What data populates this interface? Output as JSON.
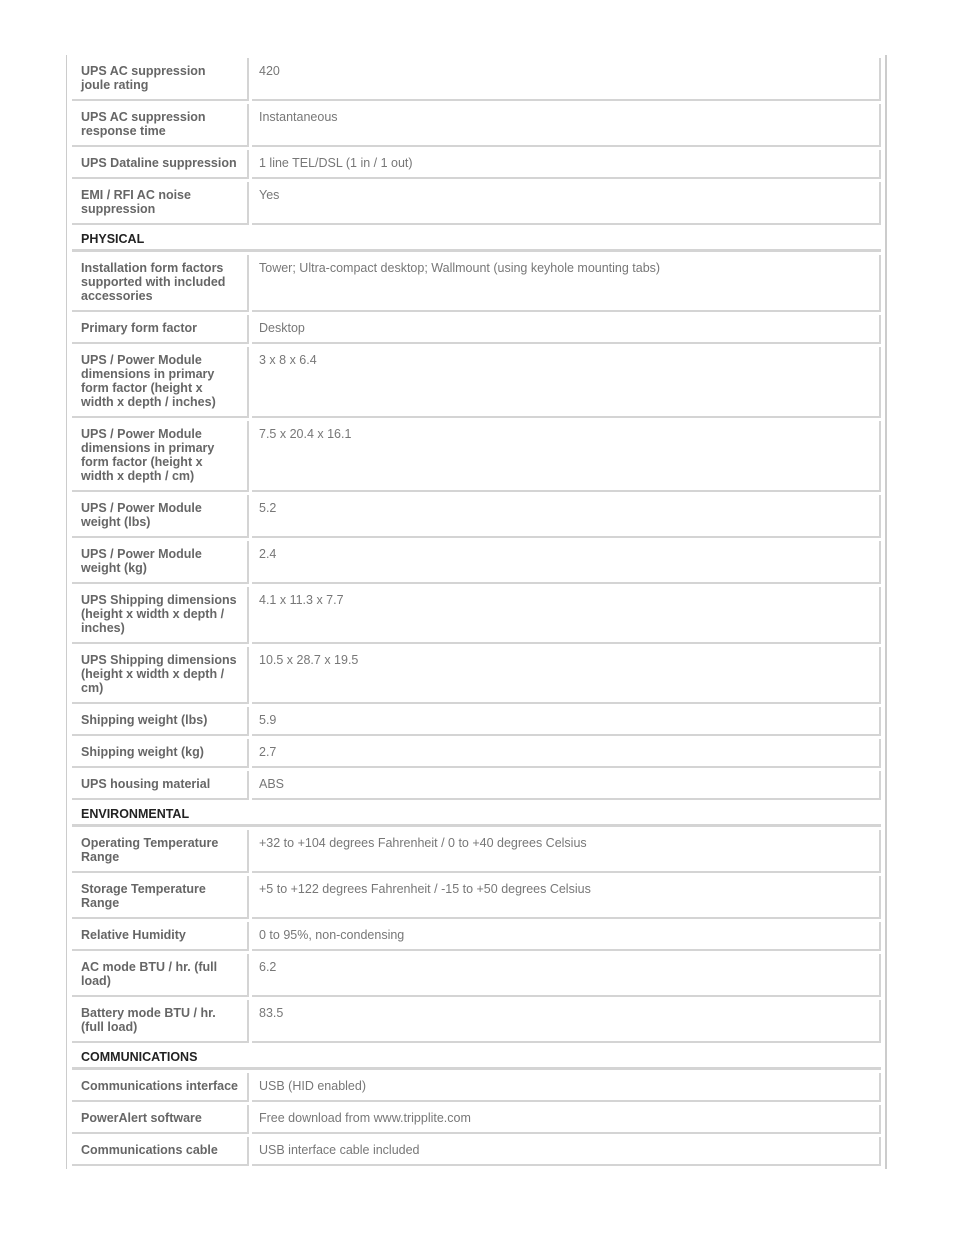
{
  "rows": [
    {
      "type": "row",
      "label": "UPS AC suppression joule rating",
      "value": "420",
      "h": 40
    },
    {
      "type": "row",
      "label": "UPS AC suppression response time",
      "value": "Instantaneous",
      "h": 40
    },
    {
      "type": "row",
      "label": "UPS Dataline suppression",
      "value": "1 line TEL/DSL (1 in / 1 out)",
      "h": 26
    },
    {
      "type": "row",
      "label": "EMI / RFI AC noise suppression",
      "value": "Yes",
      "h": 40
    },
    {
      "type": "section",
      "label": "PHYSICAL"
    },
    {
      "type": "row",
      "label": "Installation form factors supported with included accessories",
      "value": "Tower; Ultra-compact desktop; Wallmount (using keyhole mounting tabs)",
      "h": 54
    },
    {
      "type": "row",
      "label": "Primary form factor",
      "value": "Desktop",
      "h": 26
    },
    {
      "type": "row",
      "label": "UPS / Power Module dimensions in primary form factor (height x width x depth / inches)",
      "value": "3 x 8 x 6.4",
      "h": 68
    },
    {
      "type": "row",
      "label": "UPS / Power Module dimensions in primary form factor (height x width x depth / cm)",
      "value": "7.5 x 20.4 x 16.1",
      "h": 68
    },
    {
      "type": "row",
      "label": "UPS / Power Module weight (lbs)",
      "value": "5.2",
      "h": 40
    },
    {
      "type": "row",
      "label": "UPS / Power Module weight (kg)",
      "value": "2.4",
      "h": 40
    },
    {
      "type": "row",
      "label": "UPS Shipping dimensions (height x width x depth / inches)",
      "value": "4.1 x 11.3 x 7.7",
      "h": 54
    },
    {
      "type": "row",
      "label": "UPS Shipping dimensions (height x width x depth / cm)",
      "value": "10.5 x 28.7 x 19.5",
      "h": 54
    },
    {
      "type": "row",
      "label": "Shipping weight (lbs)",
      "value": "5.9",
      "h": 26
    },
    {
      "type": "row",
      "label": "Shipping weight (kg)",
      "value": "2.7",
      "h": 26
    },
    {
      "type": "row",
      "label": "UPS housing material",
      "value": "ABS",
      "h": 26
    },
    {
      "type": "section",
      "label": "ENVIRONMENTAL"
    },
    {
      "type": "row",
      "label": "Operating Temperature Range",
      "value": "+32 to +104 degrees Fahrenheit / 0 to +40 degrees Celsius",
      "h": 40
    },
    {
      "type": "row",
      "label": "Storage Temperature Range",
      "value": "+5 to +122 degrees Fahrenheit / -15 to +50 degrees Celsius",
      "h": 40
    },
    {
      "type": "row",
      "label": "Relative Humidity",
      "value": "0 to 95%, non-condensing",
      "h": 26
    },
    {
      "type": "row",
      "label": "AC mode BTU / hr. (full load)",
      "value": "6.2",
      "h": 40
    },
    {
      "type": "row",
      "label": "Battery mode BTU / hr. (full load)",
      "value": "83.5",
      "h": 40
    },
    {
      "type": "section",
      "label": "COMMUNICATIONS"
    },
    {
      "type": "row",
      "label": "Communications interface",
      "value": "USB (HID enabled)",
      "h": 26
    },
    {
      "type": "row",
      "label": "PowerAlert software",
      "value": "Free download from www.tripplite.com",
      "h": 26
    },
    {
      "type": "row",
      "label": "Communications cable",
      "value": "USB interface cable included",
      "h": 26
    }
  ]
}
